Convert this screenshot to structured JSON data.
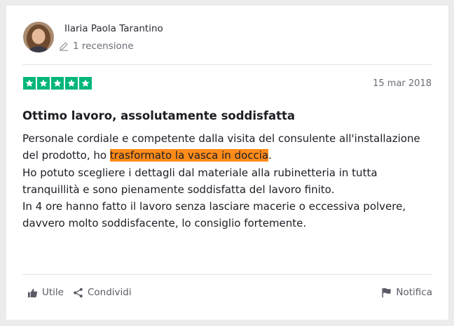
{
  "reviewer": {
    "name": "Ilaria Paola Tarantino",
    "review_count": "1 recensione",
    "avatar_icon": "user-avatar-photo"
  },
  "review": {
    "rating": 5,
    "rating_max": 5,
    "star_color": "#00b67a",
    "date": "15 mar 2018",
    "title": "Ottimo lavoro, assolutamente soddisfatta",
    "body": {
      "line1": "Personale cordiale e competente dalla visita del consulente all'installazione",
      "line2_before": "del prodotto, ho ",
      "line2_highlight": "trasformato la vasca in doccia",
      "line2_after": ".",
      "line3": "Ho potuto scegliere i dettagli dal materiale alla rubinetteria in tutta",
      "line4": "tranquillità e sono pienamente soddisfatta del lavoro finito.",
      "line5": "In 4 ore hanno fatto il lavoro senza lasciare macerie o eccessiva polvere,",
      "line6": "davvero molto soddisfacente, lo consiglio fortemente."
    },
    "highlight_color": "#ff8c1a"
  },
  "actions": {
    "like_label": "Utile",
    "share_label": "Condividi",
    "report_label": "Notifica"
  }
}
